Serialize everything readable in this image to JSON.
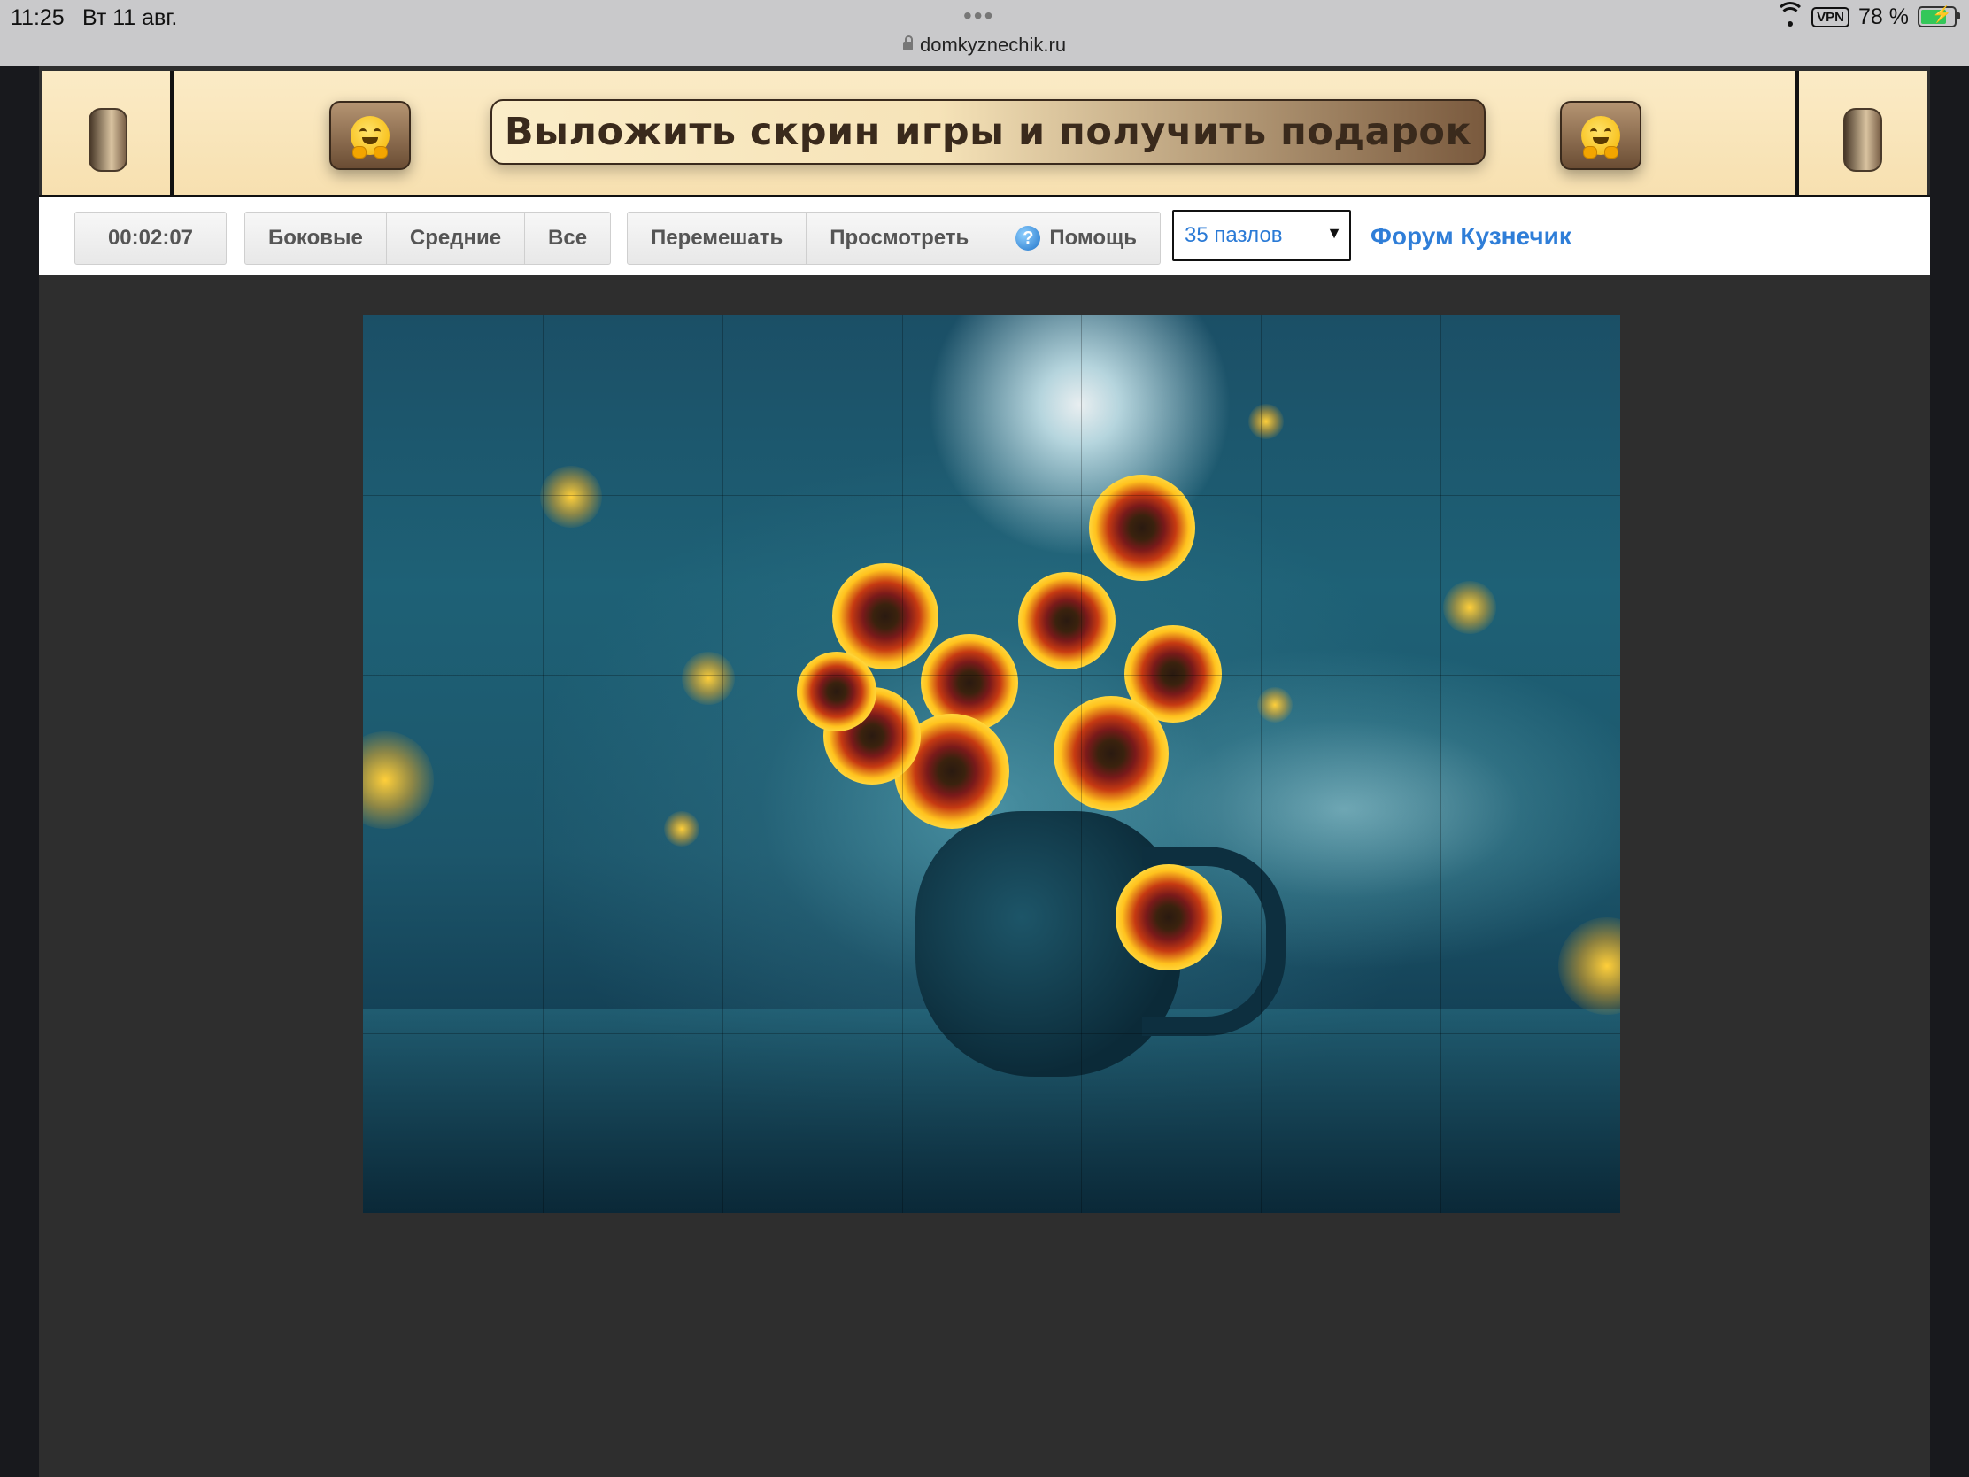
{
  "status_bar": {
    "time": "11:25",
    "date": "Вт 11 авг.",
    "url": "domkyznechik.ru",
    "vpn": "VPN",
    "battery": "78 %"
  },
  "banner": {
    "title": "Выложить скрин игры и получить подарок",
    "left_icon": "hugging-face-emoji",
    "right_icon": "hugging-face-emoji"
  },
  "toolbar": {
    "timer": "00:02:07",
    "filter_buttons": [
      "Боковые",
      "Средние",
      "Все"
    ],
    "shuffle_label": "Перемешать",
    "preview_label": "Просмотреть",
    "help_label": "Помощь",
    "pieces_select": "35 пазлов",
    "forum_link": "Форум Кузнечик"
  },
  "puzzle": {
    "description_icon": "flowers-in-jug-image",
    "columns": 7,
    "rows": 5
  },
  "colors": {
    "banner_bg": "#f9e6bd",
    "page_bg": "#2e2e2e",
    "link": "#2f7ed8"
  }
}
